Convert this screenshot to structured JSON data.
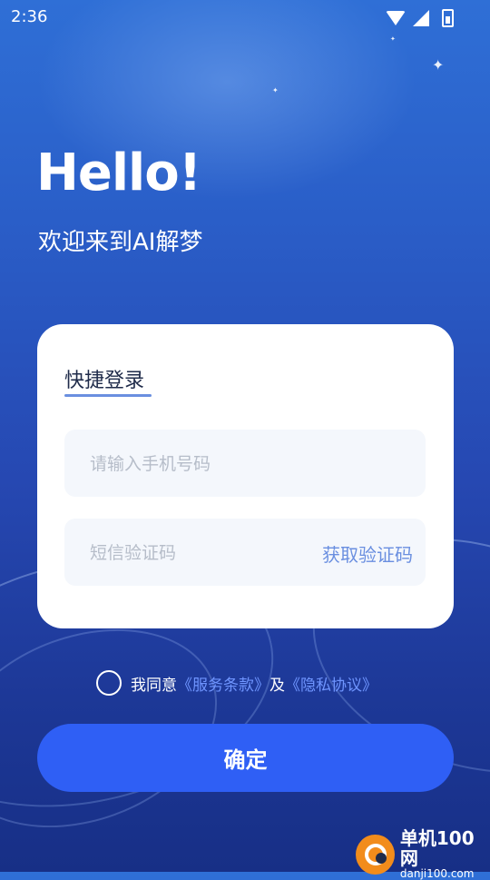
{
  "status_bar": {
    "time": "2:36"
  },
  "header": {
    "title": "Hello!",
    "subtitle": "欢迎来到AI解梦"
  },
  "login_card": {
    "tab_label": "快捷登录",
    "phone_placeholder": "请输入手机号码",
    "code_placeholder": "短信验证码",
    "get_code_label": "获取验证码"
  },
  "agreement": {
    "prefix": "我同意",
    "terms_link": "《服务条款》",
    "connector": "及",
    "privacy_link": "《隐私协议》",
    "checked": false
  },
  "confirm_label": "确定",
  "watermark": {
    "name": "单机100网",
    "url": "danji100.com"
  },
  "colors": {
    "accent": "#2f5ff5",
    "link": "#6f95ff",
    "tab_underline": "#6a8fe0"
  }
}
